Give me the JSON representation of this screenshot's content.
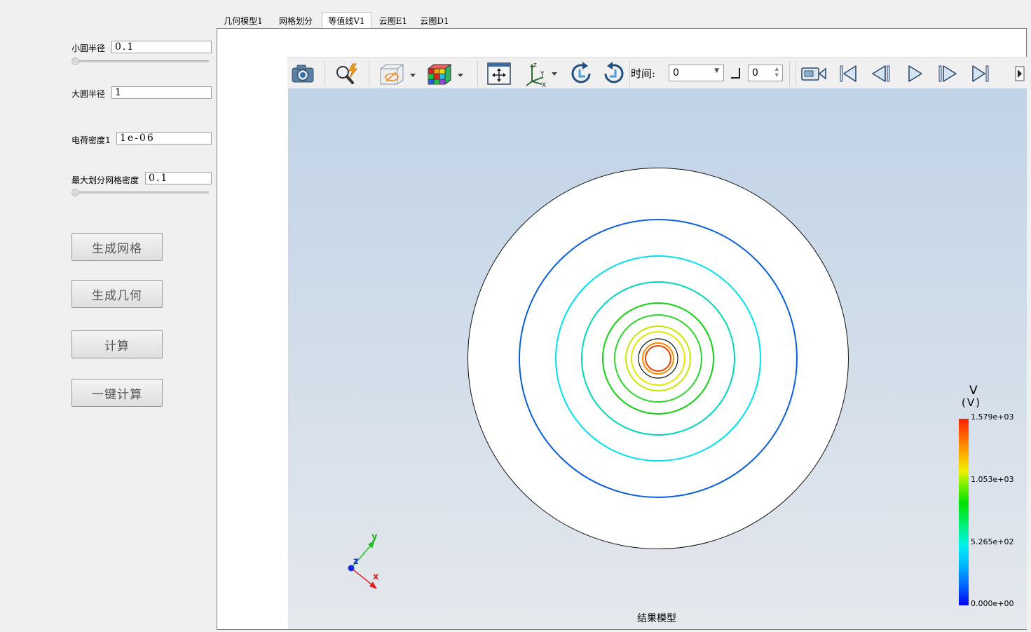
{
  "panel": {
    "small_radius_label": "小圆半径",
    "small_radius_value": "0.1",
    "large_radius_label": "大圆半径",
    "large_radius_value": "1",
    "charge_density_label": "电荷密度1",
    "charge_density_value": "1e-06",
    "max_mesh_density_label": "最大划分网格密度",
    "max_mesh_density_value": "0.1",
    "buttons": {
      "generate_mesh": "生成网格",
      "generate_geometry": "生成几何",
      "compute": "计算",
      "one_click_compute": "一键计算"
    }
  },
  "tabs": [
    {
      "label": "几何模型1",
      "active": false
    },
    {
      "label": "网格划分",
      "active": false
    },
    {
      "label": "等值线V1",
      "active": true
    },
    {
      "label": "云图E1",
      "active": false
    },
    {
      "label": "云图D1",
      "active": false
    }
  ],
  "toolbar": {
    "icons": [
      "camera-icon",
      "probe-icon",
      "box-view-icon",
      "colormap-cube-icon",
      "fit-view-icon",
      "axis-orientation-icon",
      "rotate-cw-icon",
      "rotate-ccw-icon",
      "camera-record-icon",
      "first-frame-icon",
      "step-back-icon",
      "play-icon",
      "step-forward-icon",
      "last-frame-icon"
    ],
    "time_label": "时间:",
    "time_value": "0",
    "step_value": "0"
  },
  "viewport": {
    "caption": "结果模型",
    "axes": {
      "x": "x",
      "y": "y",
      "z": "z"
    },
    "colorbar": {
      "title": "V",
      "unit": "(V)",
      "max": "1.579e+03",
      "tick2": "1.053e+03",
      "tick1": "5.265e+02",
      "min": "0.000e+00"
    },
    "contour_colors": [
      "#0a5fdc",
      "#00e3ee",
      "#00d8b8",
      "#12d212",
      "#2cd62c",
      "#c9e800",
      "#e6e600",
      "#ff8a00",
      "#e84000"
    ]
  }
}
